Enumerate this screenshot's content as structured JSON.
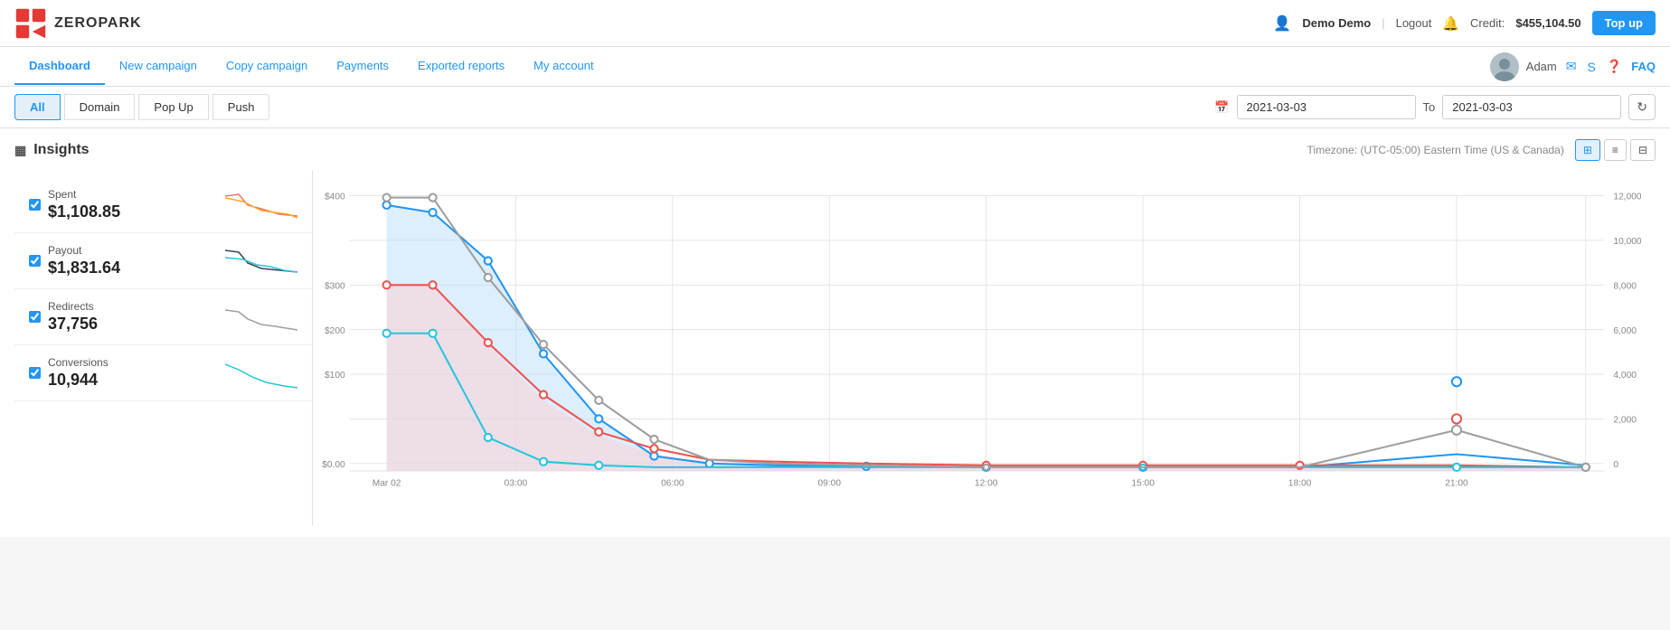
{
  "app": {
    "logo_text": "ZEROPARK"
  },
  "topnav": {
    "user_name": "Demo Demo",
    "logout_label": "Logout",
    "credit_label": "Credit:",
    "credit_amount": "$455,104.50",
    "topup_label": "Top up"
  },
  "secondnav": {
    "items": [
      {
        "label": "Dashboard",
        "active": true
      },
      {
        "label": "New campaign",
        "active": false
      },
      {
        "label": "Copy campaign",
        "active": false
      },
      {
        "label": "Payments",
        "active": false
      },
      {
        "label": "Exported reports",
        "active": false
      },
      {
        "label": "My account",
        "active": false
      }
    ],
    "user_label": "Adam",
    "faq_label": "FAQ"
  },
  "filterbar": {
    "tabs": [
      {
        "label": "All",
        "active": true
      },
      {
        "label": "Domain",
        "active": false
      },
      {
        "label": "Pop Up",
        "active": false
      },
      {
        "label": "Push",
        "active": false
      }
    ],
    "date_from": "2021-03-03",
    "date_to": "2021-03-03",
    "date_separator": "To"
  },
  "insights": {
    "title": "Insights",
    "timezone": "Timezone: (UTC-05:00) Eastern Time (US & Canada)",
    "metrics": [
      {
        "label": "Spent",
        "value": "$1,108.85",
        "checked": true
      },
      {
        "label": "Payout",
        "value": "$1,831.64",
        "checked": true
      },
      {
        "label": "Redirects",
        "value": "37,756",
        "checked": true
      },
      {
        "label": "Conversions",
        "value": "10,944",
        "checked": true
      }
    ]
  },
  "chart": {
    "x_labels": [
      "Mar 02",
      "03:00",
      "06:00",
      "09:00",
      "12:00",
      "15:00",
      "18:00",
      "21:00"
    ],
    "y_left_labels": [
      "$0.00",
      "$100",
      "$200",
      "$300",
      "$400"
    ],
    "y_right_labels": [
      "0",
      "2,000",
      "4,000",
      "6,000",
      "8,000",
      "10,000",
      "12,000"
    ],
    "colors": {
      "spent": "#e57373",
      "payout": "#26c6da",
      "redirects": "#9e9e9e",
      "conversions": "#ef5350"
    }
  }
}
